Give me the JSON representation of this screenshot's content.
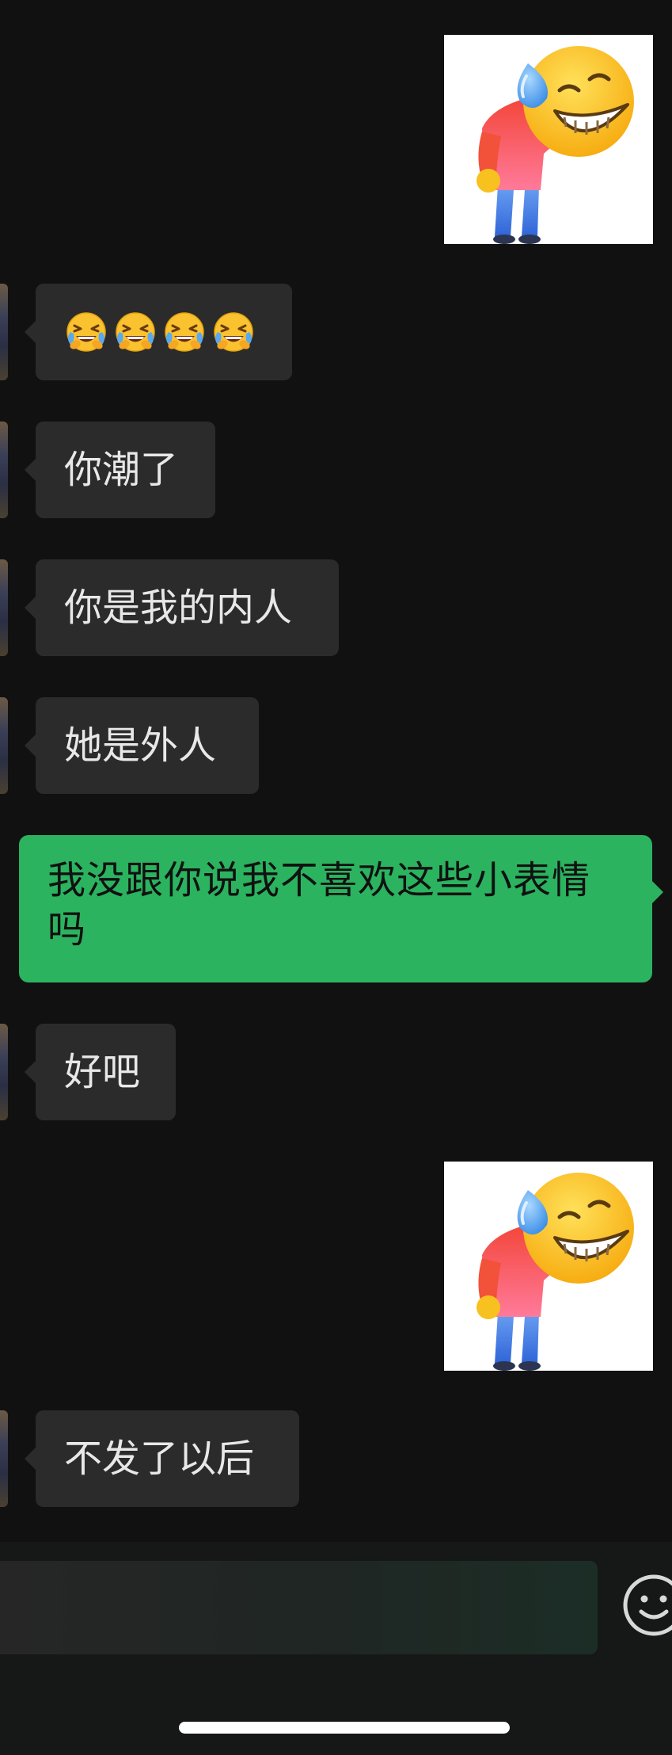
{
  "theme": {
    "background": "#111111",
    "incoming_bubble": "#2b2b2b",
    "outgoing_bubble": "#2bb35f",
    "incoming_text": "#e8e8e8",
    "outgoing_text": "#111111"
  },
  "messages": [
    {
      "direction": "outgoing",
      "type": "sticker",
      "sticker": "bowing-sweat-smile-sticker"
    },
    {
      "direction": "incoming",
      "type": "emoji",
      "emoji": [
        "laughing-crying-emoji",
        "laughing-crying-emoji",
        "laughing-crying-emoji",
        "laughing-crying-emoji"
      ]
    },
    {
      "direction": "incoming",
      "type": "text",
      "text": "你潮了"
    },
    {
      "direction": "incoming",
      "type": "text",
      "text": "你是我的内人"
    },
    {
      "direction": "incoming",
      "type": "text",
      "text": "她是外人"
    },
    {
      "direction": "outgoing",
      "type": "text",
      "lines": [
        "我没跟你说我不喜欢这些小表情",
        "吗"
      ]
    },
    {
      "direction": "incoming",
      "type": "text",
      "text": "好吧"
    },
    {
      "direction": "outgoing",
      "type": "sticker",
      "sticker": "bowing-sweat-smile-sticker"
    },
    {
      "direction": "incoming",
      "type": "text",
      "text": "不发了以后"
    }
  ],
  "composer": {
    "input_value": "",
    "emoji_button_icon": "smiley-face-icon"
  }
}
